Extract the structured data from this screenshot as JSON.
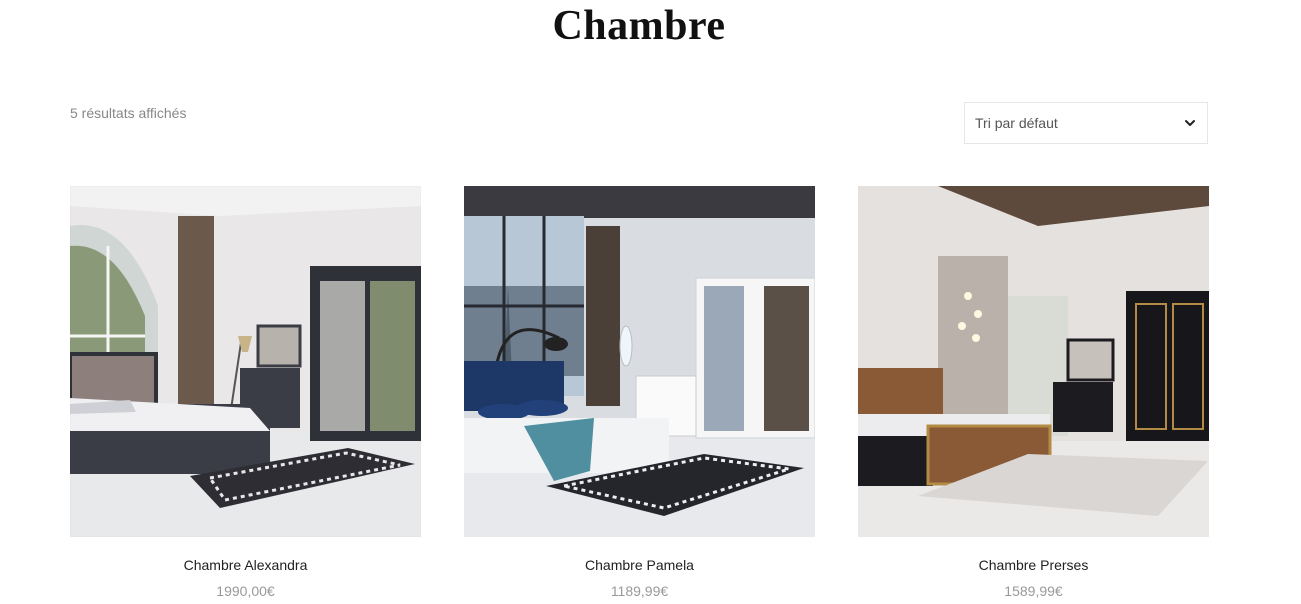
{
  "page": {
    "title": "Chambre"
  },
  "shop": {
    "result_count": "5 résultats affichés",
    "sort": {
      "selected": "Tri par défaut",
      "icon": "chevron-down-icon"
    }
  },
  "products": [
    {
      "name": "Chambre Alexandra",
      "price": "1990,00€",
      "image": "bedroom-photo-alexandra",
      "accent": "#3d4048"
    },
    {
      "name": "Chambre Pamela",
      "price": "1189,99€",
      "image": "bedroom-photo-pamela",
      "accent": "#1d3766"
    },
    {
      "name": "Chambre Prerses",
      "price": "1589,99€",
      "image": "bedroom-photo-prerses",
      "accent": "#8a5a36"
    }
  ]
}
